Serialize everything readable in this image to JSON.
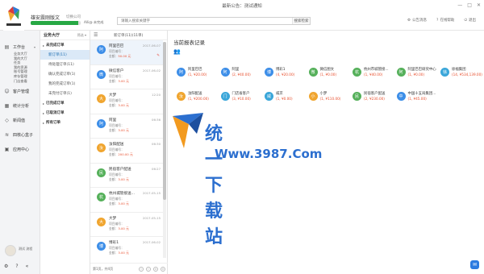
{
  "window": {
    "title": "最新公告：测试通知"
  },
  "header": {
    "brand": "雄安震刚版文",
    "brand_sub": "切换公司",
    "progress": 0.95,
    "user_text": "Alli@  未完成",
    "search_placeholder": "请输入搜索关键字",
    "search_button": "搜索检索",
    "actions": [
      "公告消息",
      "在线帮助",
      "退出"
    ]
  },
  "leftnav": {
    "items": [
      {
        "icon": "briefcase-icon",
        "label": "工作台"
      },
      {
        "icon": "user-icon",
        "label": "客户管理"
      },
      {
        "icon": "chart-icon",
        "label": "统计分析"
      },
      {
        "icon": "diamond-icon",
        "label": "新闻值"
      },
      {
        "icon": "wifi-icon",
        "label": "四核心盒子"
      },
      {
        "icon": "grid-icon",
        "label": "应用中心"
      }
    ],
    "sub_items": [
      "业务大厅",
      "我的大厅",
      "任务",
      "我的资源",
      "账号管理",
      "库存管理",
      "门店查看"
    ],
    "user_name": "测试 流程"
  },
  "panel2": {
    "title": "业务大厅",
    "filter": "筛选 ▾",
    "items": [
      {
        "type": "group",
        "label": "未完成订单"
      },
      {
        "type": "sub",
        "label": "新订单(11)",
        "active": true
      },
      {
        "type": "sub",
        "label": "待处理订单(11)"
      },
      {
        "type": "sub",
        "label": "确认完成订单(1)"
      },
      {
        "type": "sub",
        "label": "我的完成订单(1)"
      },
      {
        "type": "sub",
        "label": "未完付订单(1)"
      },
      {
        "type": "group",
        "label": "已完成订单"
      },
      {
        "type": "group",
        "label": "已取消订单"
      },
      {
        "type": "group",
        "label": "所有订单"
      }
    ]
  },
  "list": {
    "title": "新订单(11)(11单)",
    "cards": [
      {
        "avatar": "阿",
        "color": "#3d8ee8",
        "name": "阿里巴巴",
        "date": "2017-06-07",
        "line2": "项目编号：",
        "line3_label": "金额：",
        "amount": "50.00 元",
        "selected": true,
        "pin": true
      },
      {
        "avatar": "微",
        "color": "#3d8ee8",
        "name": "微信客户",
        "date": "2017-06-02",
        "line2": "项目编号：",
        "line3_label": "金额：",
        "amount": "3.00 元"
      },
      {
        "avatar": "大",
        "color": "#f0a52f",
        "name": "大梦",
        "date": "12:20",
        "line2": "项目编号：",
        "line3_label": "金额：",
        "amount": "3.00 元"
      },
      {
        "avatar": "阿",
        "color": "#3d8ee8",
        "name": "阿里",
        "date": "06:36",
        "line2": "项目编号：",
        "line3_label": "金额：",
        "amount": "3.00 元"
      },
      {
        "avatar": "汝",
        "color": "#f0a52f",
        "name": "汝阳配送",
        "date": "06:30",
        "line2": "项目编号：",
        "line3_label": "金额：",
        "amount": "200.00 元"
      },
      {
        "avatar": "民",
        "color": "#55b05a",
        "name": "民宿客户配送",
        "date": "06:27",
        "line2": "项目编号：",
        "line3_label": "金额：",
        "amount": "3.00 元"
      },
      {
        "avatar": "杭",
        "color": "#55b05a",
        "name": "杭州城管接送...",
        "date": "2017-05-15",
        "line2": "项目编号：",
        "line3_label": "金额：",
        "amount": "3.00 元"
      },
      {
        "avatar": "大",
        "color": "#f0a52f",
        "name": "大梦",
        "date": "2017-05-15",
        "line2": "项目编号：",
        "line3_label": "金额：",
        "amount": "3.00 元"
      },
      {
        "avatar": "博",
        "color": "#3d8ee8",
        "name": "博彩1",
        "date": "2017-06-02",
        "line2": "项目编号：",
        "line3_label": "金额：",
        "amount": "3.00 元"
      }
    ],
    "footer": "第1页，共4页",
    "pager": [
      "‹",
      "›",
      "«",
      "»"
    ]
  },
  "content": {
    "title": "当前报表记录",
    "grid": [
      {
        "icon": "阿",
        "color": "#3d8ee8",
        "name": "阿里巴巴",
        "value": "(1, ¥20.00)"
      },
      {
        "icon": "阿",
        "color": "#3d8ee8",
        "name": "阿里",
        "value": "(2, ¥40.00)"
      },
      {
        "icon": "博",
        "color": "#3d8ee8",
        "name": "博彩1",
        "value": "(4, ¥20.00)"
      },
      {
        "icon": "微",
        "color": "#55b05a",
        "name": "微信图文",
        "value": "(1, ¥0.00)"
      },
      {
        "icon": "杭",
        "color": "#55b05a",
        "name": "杭州市城管接...",
        "value": "(1, ¥40.00)"
      },
      {
        "icon": "阿",
        "color": "#55b05a",
        "name": "阿里巴巴研究中心",
        "value": "(1, ¥0.00)"
      },
      {
        "icon": "徐",
        "color": "#3aa6d9",
        "name": "徐福集团",
        "value": "(14, ¥534,139.00)"
      },
      {
        "icon": "汝",
        "color": "#f0a52f",
        "name": "汝阳配送",
        "value": "(1, ¥200.00)"
      },
      {
        "icon": "门",
        "color": "#3aa6d9",
        "name": "门店省客户",
        "value": "(3, ¥10.00)"
      },
      {
        "icon": "威",
        "color": "#3aa6d9",
        "name": "威京",
        "value": "(1, ¥0.00)"
      },
      {
        "icon": "小",
        "color": "#f0a52f",
        "name": "小梦",
        "value": "(1, ¥110.00)"
      },
      {
        "icon": "民",
        "color": "#55b05a",
        "name": "民宿客户配送",
        "value": "(2, ¥230.00)"
      },
      {
        "icon": "中",
        "color": "#3d8ee8",
        "name": "中国十五局集团...",
        "value": "(1, ¥45.00)"
      }
    ]
  },
  "watermark": {
    "main": "统一下载站",
    "url": "Www.3987.Com"
  }
}
